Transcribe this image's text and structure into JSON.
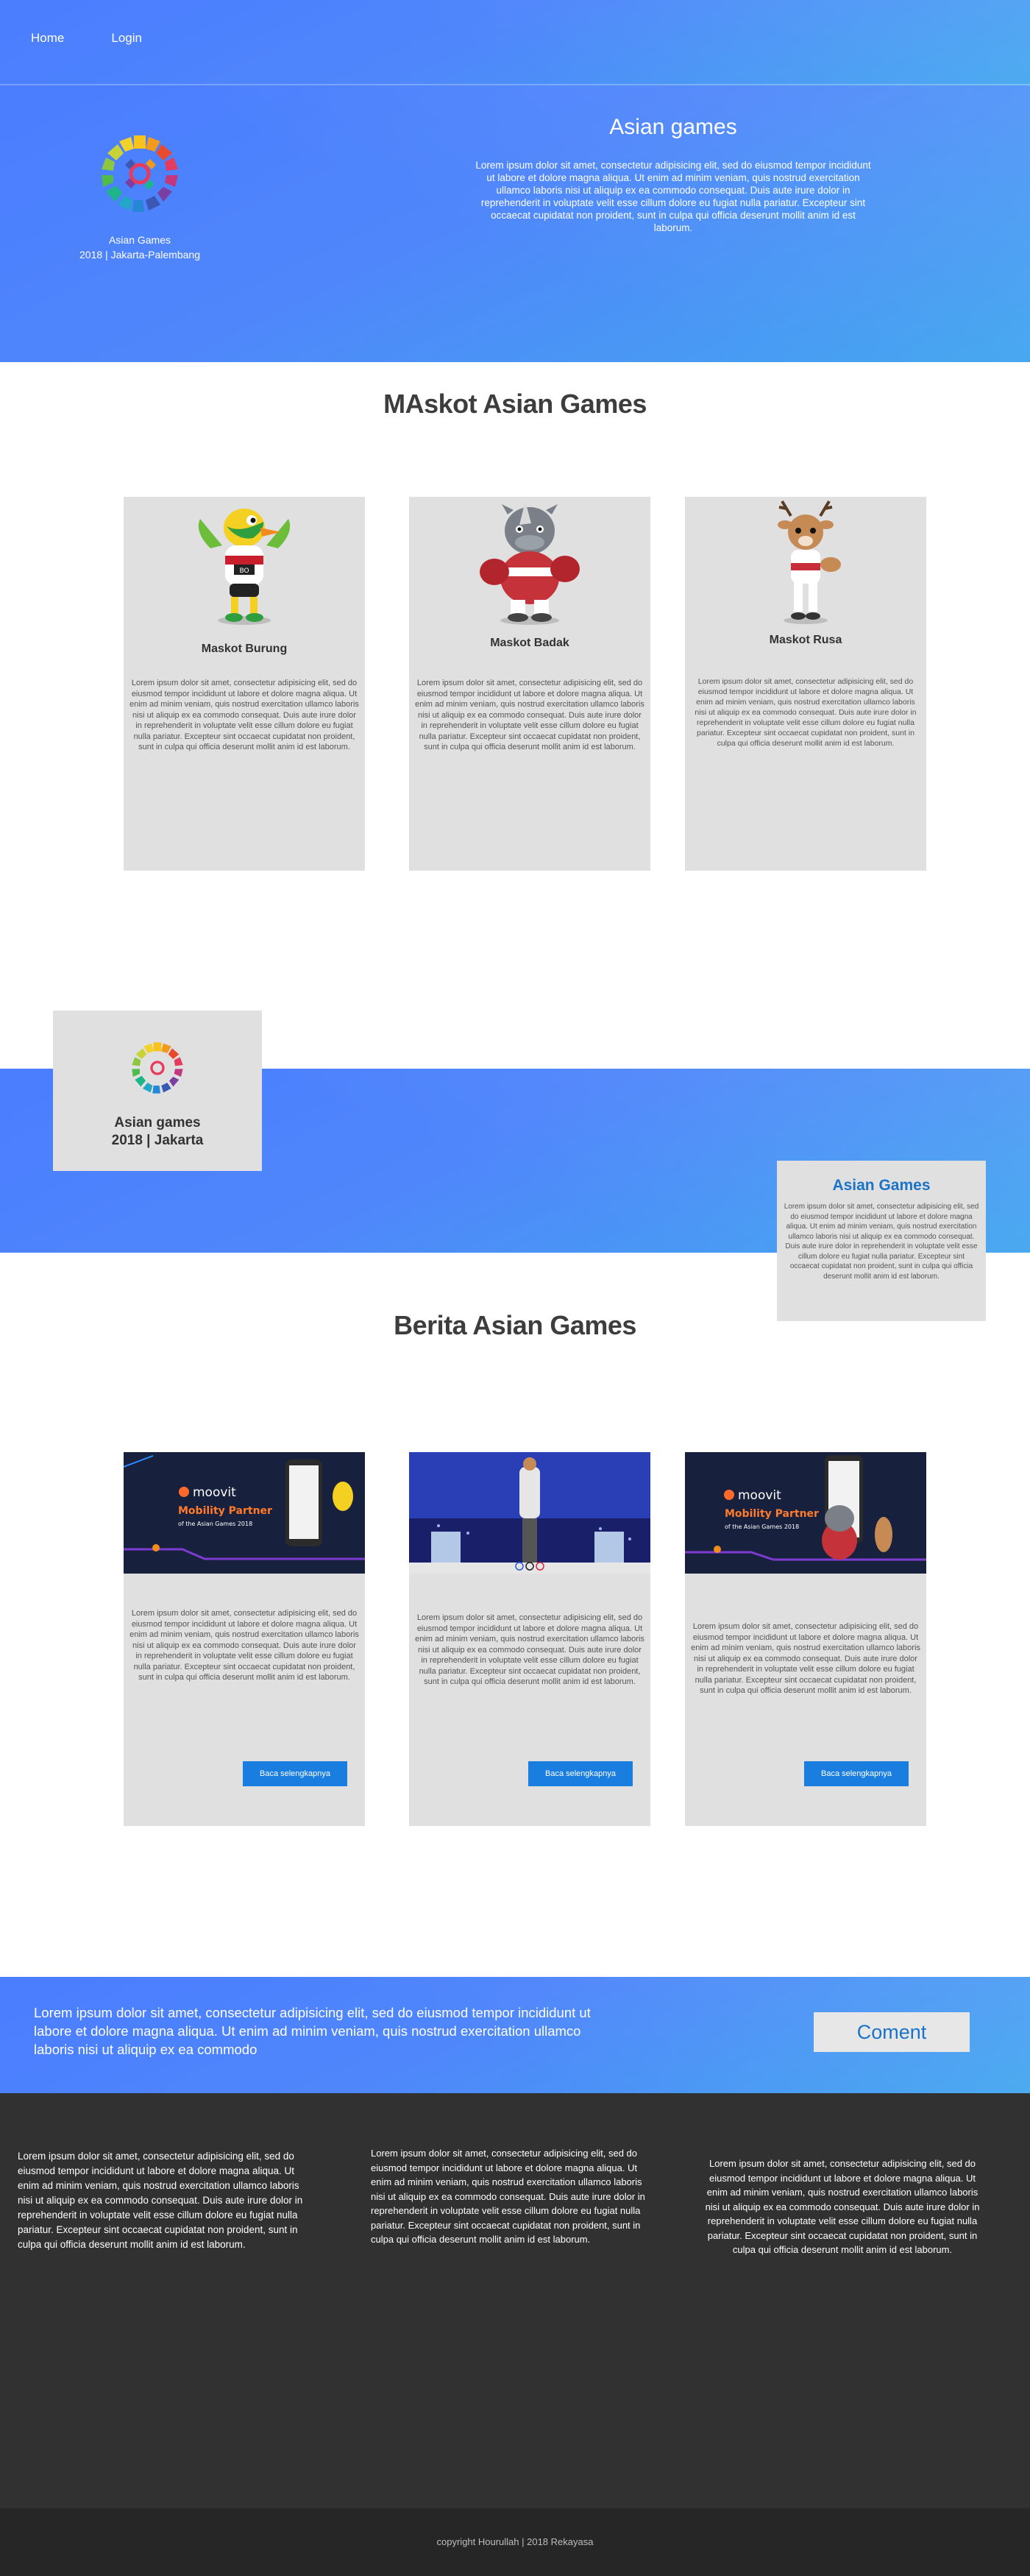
{
  "nav": {
    "home": "Home",
    "login": "Login"
  },
  "hero": {
    "logo_caption_line1": "Asian Games",
    "logo_caption_line2": "2018 | Jakarta-Palembang",
    "title": "Asian games",
    "text": "Lorem ipsum dolor sit amet, consectetur adipisicing elit, sed do eiusmod tempor incididunt ut labore et dolore magna aliqua. Ut enim ad minim veniam, quis nostrud exercitation ullamco laboris nisi ut aliquip ex ea commodo consequat. Duis aute irure dolor in reprehenderit in voluptate velit esse cillum dolore eu fugiat nulla pariatur. Excepteur sint occaecat cupidatat non proident, sunt in culpa qui officia deserunt mollit anim id est laborum."
  },
  "mascots": {
    "title": "MAskot Asian Games",
    "items": [
      {
        "name": "Maskot Burung",
        "text": "Lorem ipsum dolor sit amet, consectetur adipisicing elit, sed do eiusmod tempor incididunt ut labore et dolore magna aliqua. Ut enim ad minim veniam, quis nostrud exercitation ullamco laboris nisi ut aliquip ex ea commodo consequat. Duis aute irure dolor in reprehenderit in voluptate velit esse cillum dolore eu fugiat nulla pariatur. Excepteur sint occaecat cupidatat non proident, sunt in culpa qui officia deserunt mollit anim id est laborum."
      },
      {
        "name": "Maskot Badak",
        "text": "Lorem ipsum dolor sit amet, consectetur adipisicing elit, sed do eiusmod tempor incididunt ut labore et dolore magna aliqua. Ut enim ad minim veniam, quis nostrud exercitation ullamco laboris nisi ut aliquip ex ea commodo consequat. Duis aute irure dolor in reprehenderit in voluptate velit esse cillum dolore eu fugiat nulla pariatur. Excepteur sint occaecat cupidatat non proident, sunt in culpa qui officia deserunt mollit anim id est laborum."
      },
      {
        "name": "Maskot Rusa",
        "text": "Lorem ipsum dolor sit amet, consectetur adipisicing elit, sed do eiusmod tempor incididunt ut labore et dolore magna aliqua. Ut enim ad minim veniam, quis nostrud exercitation ullamco laboris nisi ut aliquip ex ea commodo consequat. Duis aute irure dolor in reprehenderit in voluptate velit esse cillum dolore eu fugiat nulla pariatur. Excepteur sint occaecat cupidatat non proident, sunt in culpa qui officia deserunt mollit anim id est laborum."
      }
    ]
  },
  "banner": {
    "label_line1": "Asian games",
    "label_line2": "2018 | Jakarta",
    "side_title": "Asian Games",
    "side_text": "Lorem ipsum dolor sit amet, consectetur adipisicing elit, sed do eiusmod tempor incididunt ut labore et dolore magna aliqua. Ut enim ad minim veniam, quis nostrud exercitation ullamco laboris nisi ut aliquip ex ea commodo consequat. Duis aute irure dolor in reprehenderit in voluptate velit esse cillum dolore eu fugiat nulla pariatur. Excepteur sint occaecat cupidatat non proident, sunt in culpa qui officia deserunt mollit anim id est laborum."
  },
  "news": {
    "title": "Berita Asian Games",
    "items": [
      {
        "brand": "moovit",
        "headline1": "Mobility Partner",
        "headline2": "of the Asian Games 2018",
        "button": "Baca selengkapnya",
        "text": "Lorem ipsum dolor sit amet, consectetur adipisicing elit, sed do eiusmod tempor incididunt ut labore et dolore magna aliqua. Ut enim ad minim veniam, quis nostrud exercitation ullamco laboris nisi ut aliquip ex ea commodo consequat. Duis aute irure dolor in reprehenderit in voluptate velit esse cillum dolore eu fugiat nulla pariatur. Excepteur sint occaecat cupidatat non proident, sunt in culpa qui officia deserunt mollit anim id est laborum."
      },
      {
        "button": "Baca selengkapnya",
        "text": "Lorem ipsum dolor sit amet, consectetur adipisicing elit, sed do eiusmod tempor incididunt ut labore et dolore magna aliqua. Ut enim ad minim veniam, quis nostrud exercitation ullamco laboris nisi ut aliquip ex ea commodo consequat. Duis aute irure dolor in reprehenderit in voluptate velit esse cillum dolore eu fugiat nulla pariatur. Excepteur sint occaecat cupidatat non proident, sunt in culpa qui officia deserunt mollit anim id est laborum."
      },
      {
        "brand": "moovit",
        "headline1": "Mobility Partner",
        "headline2": "of the Asian Games 2018",
        "button": "Baca selengkapnya",
        "text": "Lorem ipsum dolor sit amet, consectetur adipisicing elit, sed do eiusmod tempor incididunt ut labore et dolore magna aliqua. Ut enim ad minim veniam, quis nostrud exercitation ullamco laboris nisi ut aliquip ex ea commodo consequat. Duis aute irure dolor in reprehenderit in voluptate velit esse cillum dolore eu fugiat nulla pariatur. Excepteur sint occaecat cupidatat non proident, sunt in culpa qui officia deserunt mollit anim id est laborum."
      }
    ]
  },
  "cta": {
    "text": "Lorem ipsum dolor sit amet, consectetur adipisicing elit, sed do eiusmod tempor incididunt ut labore et dolore magna aliqua. Ut enim ad minim veniam, quis nostrud exercitation ullamco laboris nisi ut aliquip ex ea commodo",
    "button": "Coment"
  },
  "footer": {
    "col1": "Lorem ipsum dolor sit amet, consectetur adipisicing elit, sed do eiusmod tempor incididunt ut labore et dolore magna aliqua. Ut enim ad minim veniam, quis nostrud exercitation ullamco laboris nisi ut aliquip ex ea commodo consequat. Duis aute irure dolor in reprehenderit in voluptate velit esse cillum dolore eu fugiat nulla pariatur. Excepteur sint occaecat cupidatat non proident, sunt in culpa qui officia deserunt mollit anim id est laborum.",
    "col2": "Lorem ipsum dolor sit amet, consectetur adipisicing elit, sed do eiusmod tempor incididunt ut labore et dolore magna aliqua. Ut enim ad minim veniam, quis nostrud exercitation ullamco laboris nisi ut aliquip ex ea commodo consequat. Duis aute irure dolor in reprehenderit in voluptate velit esse cillum dolore eu fugiat nulla pariatur. Excepteur sint occaecat cupidatat non proident, sunt in culpa qui officia deserunt mollit anim id est laborum.",
    "col3": "Lorem ipsum dolor sit amet, consectetur adipisicing elit, sed do eiusmod tempor incididunt ut labore et dolore magna aliqua. Ut enim ad minim veniam, quis nostrud exercitation ullamco laboris nisi ut aliquip ex ea commodo consequat. Duis aute irure dolor in reprehenderit in voluptate velit esse cillum dolore eu fugiat nulla pariatur. Excepteur sint occaecat cupidatat non proident, sunt in culpa qui officia deserunt mollit anim id est laborum.",
    "copyright": "copyright Hourullah | 2018 Rekayasa"
  },
  "colors": {
    "gradient_start": "#4a7dff",
    "gradient_end": "#43a6ef",
    "accent_blue": "#1a7ee0",
    "footer_bg": "#313131"
  },
  "icons": {
    "logo": "asian-games-logo",
    "mascot1": "bird-mascot",
    "mascot2": "rhino-mascot",
    "mascot3": "deer-mascot"
  }
}
